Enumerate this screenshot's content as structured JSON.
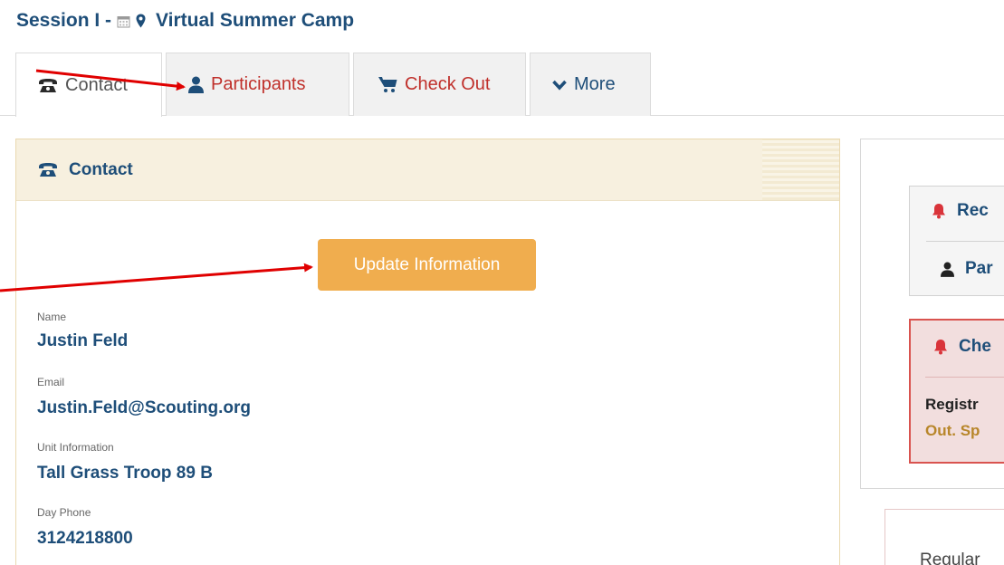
{
  "header": {
    "title_prefix": "Session I -",
    "title_main": "Virtual Summer Camp"
  },
  "tabs": [
    {
      "label": "Contact",
      "icon": "phone-icon",
      "active": true
    },
    {
      "label": "Participants",
      "icon": "user-icon",
      "active": false
    },
    {
      "label": "Check Out",
      "icon": "cart-icon",
      "active": false
    },
    {
      "label": "More",
      "icon": "chevron-down-icon",
      "active": false
    }
  ],
  "contact_panel": {
    "heading": "Contact",
    "update_button": "Update Information",
    "fields": [
      {
        "label": "Name",
        "value": "Justin Feld"
      },
      {
        "label": "Email",
        "value": "Justin.Feld@Scouting.org"
      },
      {
        "label": "Unit Information",
        "value": "Tall Grass Troop 89 B"
      },
      {
        "label": "Day Phone",
        "value": "3124218800"
      }
    ]
  },
  "sidebar": {
    "required_heading": "Rec",
    "participants_item": "Par",
    "checkout_heading": "Che",
    "warning_line1": "Registr",
    "warning_line2": "Out. Sp",
    "bottom_label": "Regular"
  },
  "colors": {
    "primary": "#1e4e79",
    "tab_link": "#c0302b",
    "button": "#f0ad4e",
    "panel_head": "#f7f0df",
    "alert": "#d9534f",
    "annotation_arrow": "#e00000"
  }
}
